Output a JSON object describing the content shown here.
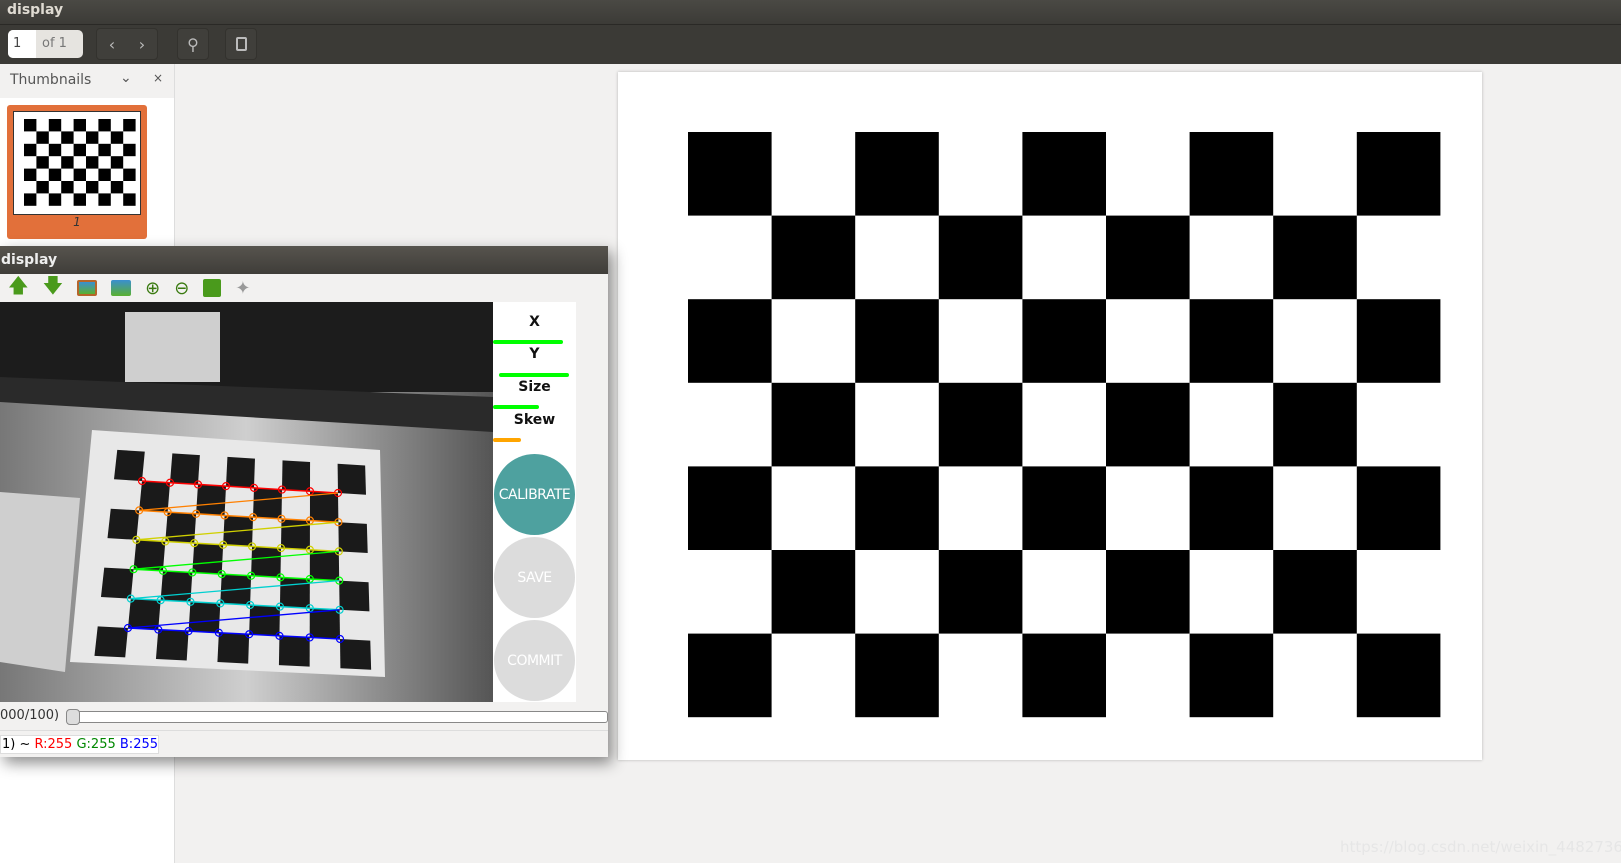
{
  "app": {
    "title": "display"
  },
  "toolbar": {
    "page_current": "1",
    "page_of": "of 1",
    "icons": [
      "chevron-left-icon",
      "chevron-right-icon",
      "search-icon",
      "clipboard-icon"
    ]
  },
  "sidebar": {
    "title": "Thumbnails",
    "thumbnails": [
      {
        "page": "1"
      }
    ]
  },
  "document": {
    "checkerboard": {
      "columns": 9,
      "rows": 7,
      "first_square": "black"
    }
  },
  "window": {
    "title": "display",
    "toolbar_icons": [
      "arrow-up-icon",
      "arrow-down-icon",
      "image-icon",
      "zoom-fit-icon",
      "zoom-in-icon",
      "zoom-out-icon",
      "save-icon",
      "brush-icon"
    ],
    "panel": {
      "metrics": [
        {
          "label": "X",
          "value": 0.88,
          "color": "#00ff00"
        },
        {
          "label": "Y",
          "value": 0.88,
          "color": "#00ff00"
        },
        {
          "label": "Size",
          "value": 0.58,
          "color": "#00ff00"
        },
        {
          "label": "Skew",
          "value": 0.35,
          "color": "#ffa500"
        }
      ],
      "buttons": [
        {
          "label": "CALIBRATE",
          "color": "#4ea19f",
          "enabled": true
        },
        {
          "label": "SAVE",
          "color": "#dcdcdc",
          "enabled": false
        },
        {
          "label": "COMMIT",
          "color": "#dcdcdc",
          "enabled": false
        }
      ]
    },
    "camera": {
      "row_colors": [
        "#ff0000",
        "#ff8000",
        "#d0d000",
        "#00ff00",
        "#00d0d0",
        "#0000ff"
      ],
      "corners_per_row": 8
    },
    "slider": {
      "label": "000/100)",
      "value": 0
    },
    "status": {
      "prefix": "1) ~ ",
      "r": "R:255",
      "g": "G:255",
      "b": "B:255"
    }
  },
  "watermark": "https://blog.csdn.net/weixin_44827364"
}
